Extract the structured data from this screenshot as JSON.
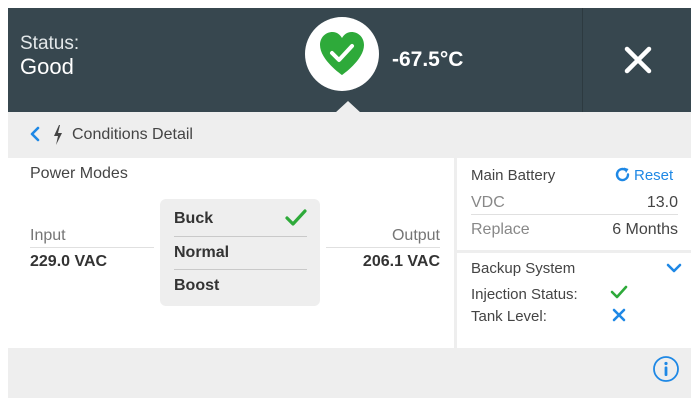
{
  "header": {
    "status_label": "Status:",
    "status_value": "Good",
    "temperature": "-67.5°C",
    "heart_icon": "heart-check-icon",
    "close_icon": "close-icon"
  },
  "subheader": {
    "back_icon": "chevron-left-icon",
    "bolt_icon": "bolt-icon",
    "title": "Conditions Detail"
  },
  "power_modes": {
    "title": "Power Modes",
    "input_label": "Input",
    "input_value": "229.0 VAC",
    "output_label": "Output",
    "output_value": "206.1 VAC",
    "modes": [
      {
        "label": "Buck",
        "selected": true
      },
      {
        "label": "Normal",
        "selected": false
      },
      {
        "label": "Boost",
        "selected": false
      }
    ]
  },
  "main_battery": {
    "title": "Main Battery",
    "reset_label": "Reset",
    "rows": [
      {
        "label": "VDC",
        "value": "13.0"
      },
      {
        "label": "Replace",
        "value": "6 Months"
      }
    ]
  },
  "backup_system": {
    "title": "Backup System",
    "injection_label": "Injection Status:",
    "injection_icon": "check-icon",
    "tank_label": "Tank Level:",
    "tank_icon": "x-icon"
  },
  "footer": {
    "info_icon": "info-icon"
  },
  "colors": {
    "header_bg": "#37474f",
    "accent_green": "#2eaa3a",
    "accent_blue": "#1e88e5",
    "panel_gray": "#eeeeee"
  }
}
